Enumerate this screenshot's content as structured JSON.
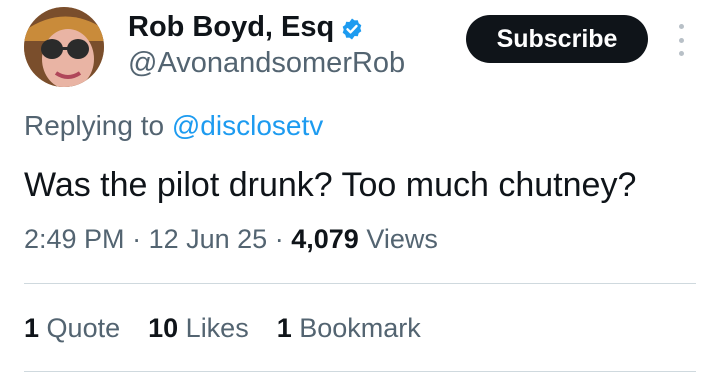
{
  "author": {
    "display_name": "Rob Boyd, Esq",
    "handle": "@AvonandsomerRob",
    "verified_color": "#1d9bf0"
  },
  "subscribe_label": "Subscribe",
  "reply": {
    "prefix": "Replying to",
    "mention": "@disclosetv"
  },
  "tweet_text": "Was the pilot drunk? Too much chutney?",
  "meta": {
    "time": "2:49 PM",
    "separator": "·",
    "date": "12 Jun 25",
    "views_count": "4,079",
    "views_label": "Views"
  },
  "stats": [
    {
      "count": "1",
      "label": "Quote"
    },
    {
      "count": "10",
      "label": "Likes"
    },
    {
      "count": "1",
      "label": "Bookmark"
    }
  ],
  "icons": {
    "verified": "verified-badge-icon",
    "more": "more-vertical-icon"
  }
}
